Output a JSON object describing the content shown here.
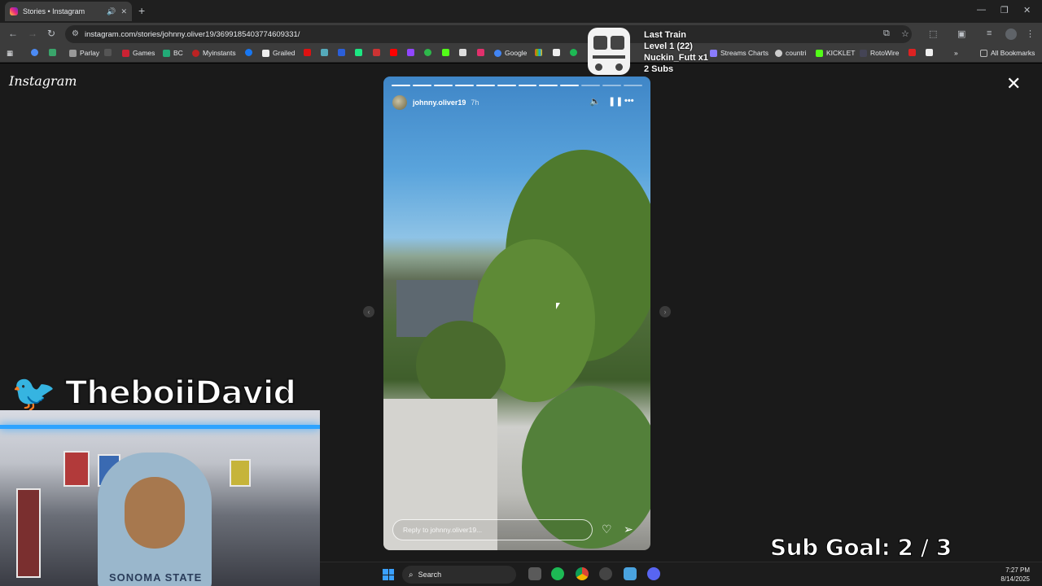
{
  "browser": {
    "tab_title": "Stories • Instagram",
    "url": "instagram.com/stories/johnny.oliver19/3699185403774609331/",
    "bookmarks": [
      "Parlay",
      "Games",
      "BC",
      "Myinstants",
      "Grailed",
      "Google",
      "Streams Charts",
      "countri",
      "KICKLET",
      "RotoWire"
    ],
    "all_bookmarks": "All Bookmarks"
  },
  "instagram": {
    "logo": "Instagram",
    "story": {
      "username": "johnny.oliver19",
      "time": "7h",
      "reply_placeholder": "Reply to johnny.oliver19...",
      "progress_segments_total": 12,
      "progress_segments_done": 9
    }
  },
  "overlay": {
    "train_title": "Last Train",
    "train_level": "Level 1  (22)",
    "train_user": "Nuckin_Futt x1",
    "train_subs": "2 Subs",
    "twitter_handle": "TheboiiDavid",
    "shirt_text": "SONOMA STATE",
    "sub_goal": "Sub Goal:  2 / 3"
  },
  "taskbar": {
    "search_label": "Search",
    "time": "7:27 PM",
    "date": "8/14/2025"
  },
  "colors": {
    "accent_twitter": "#1da1f2",
    "taskbar_bg": "#1c1c1c",
    "page_bg": "#1a1a1a"
  }
}
